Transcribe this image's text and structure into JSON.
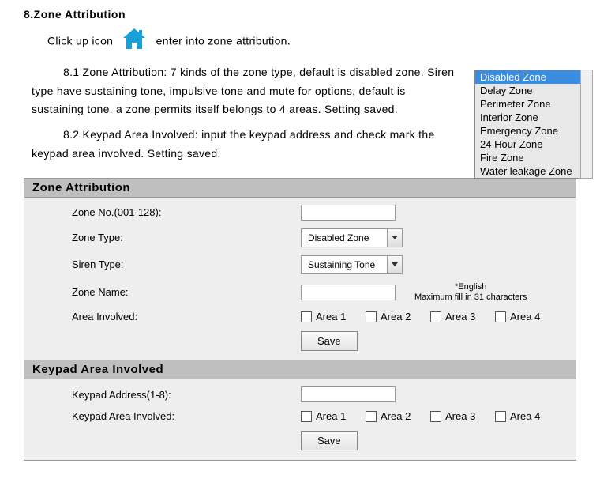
{
  "heading": "8.Zone Attribution",
  "intro_before_icon": "Click up icon",
  "intro_after_icon": "enter into zone attribution.",
  "para81": "8.1 Zone Attribution: 7 kinds of the zone type, default is disabled zone. Siren type have sustaining tone, impulsive tone and mute for options, default is sustaining tone. a zone permits itself belongs to 4 areas. Setting saved.",
  "para82": "8.2 Keypad Area Involved: input the keypad address and check mark the keypad area involved. Setting saved.",
  "zone_list": {
    "items": [
      "Disabled Zone",
      "Delay Zone",
      "Perimeter Zone",
      "Interior Zone",
      "Emergency Zone",
      "24 Hour Zone",
      "Fire Zone",
      "Water leakage Zone"
    ]
  },
  "panel": {
    "section1_title": "Zone Attribution",
    "zone_no_label": "Zone No.(001-128):",
    "zone_type_label": "Zone Type:",
    "zone_type_value": "Disabled Zone",
    "siren_type_label": "Siren Type:",
    "siren_type_value": "Sustaining Tone",
    "zone_name_label": "Zone Name:",
    "zone_name_hint_top": "*English",
    "zone_name_hint_bot": "Maximum fill in 31 characters",
    "area_involved_label": "Area Involved:",
    "areas": [
      "Area 1",
      "Area 2",
      "Area 3",
      "Area 4"
    ],
    "save_label": "Save",
    "section2_title": "Keypad Area Involved",
    "keypad_addr_label": "Keypad Address(1-8):",
    "keypad_area_label": "Keypad Area Involved:"
  }
}
